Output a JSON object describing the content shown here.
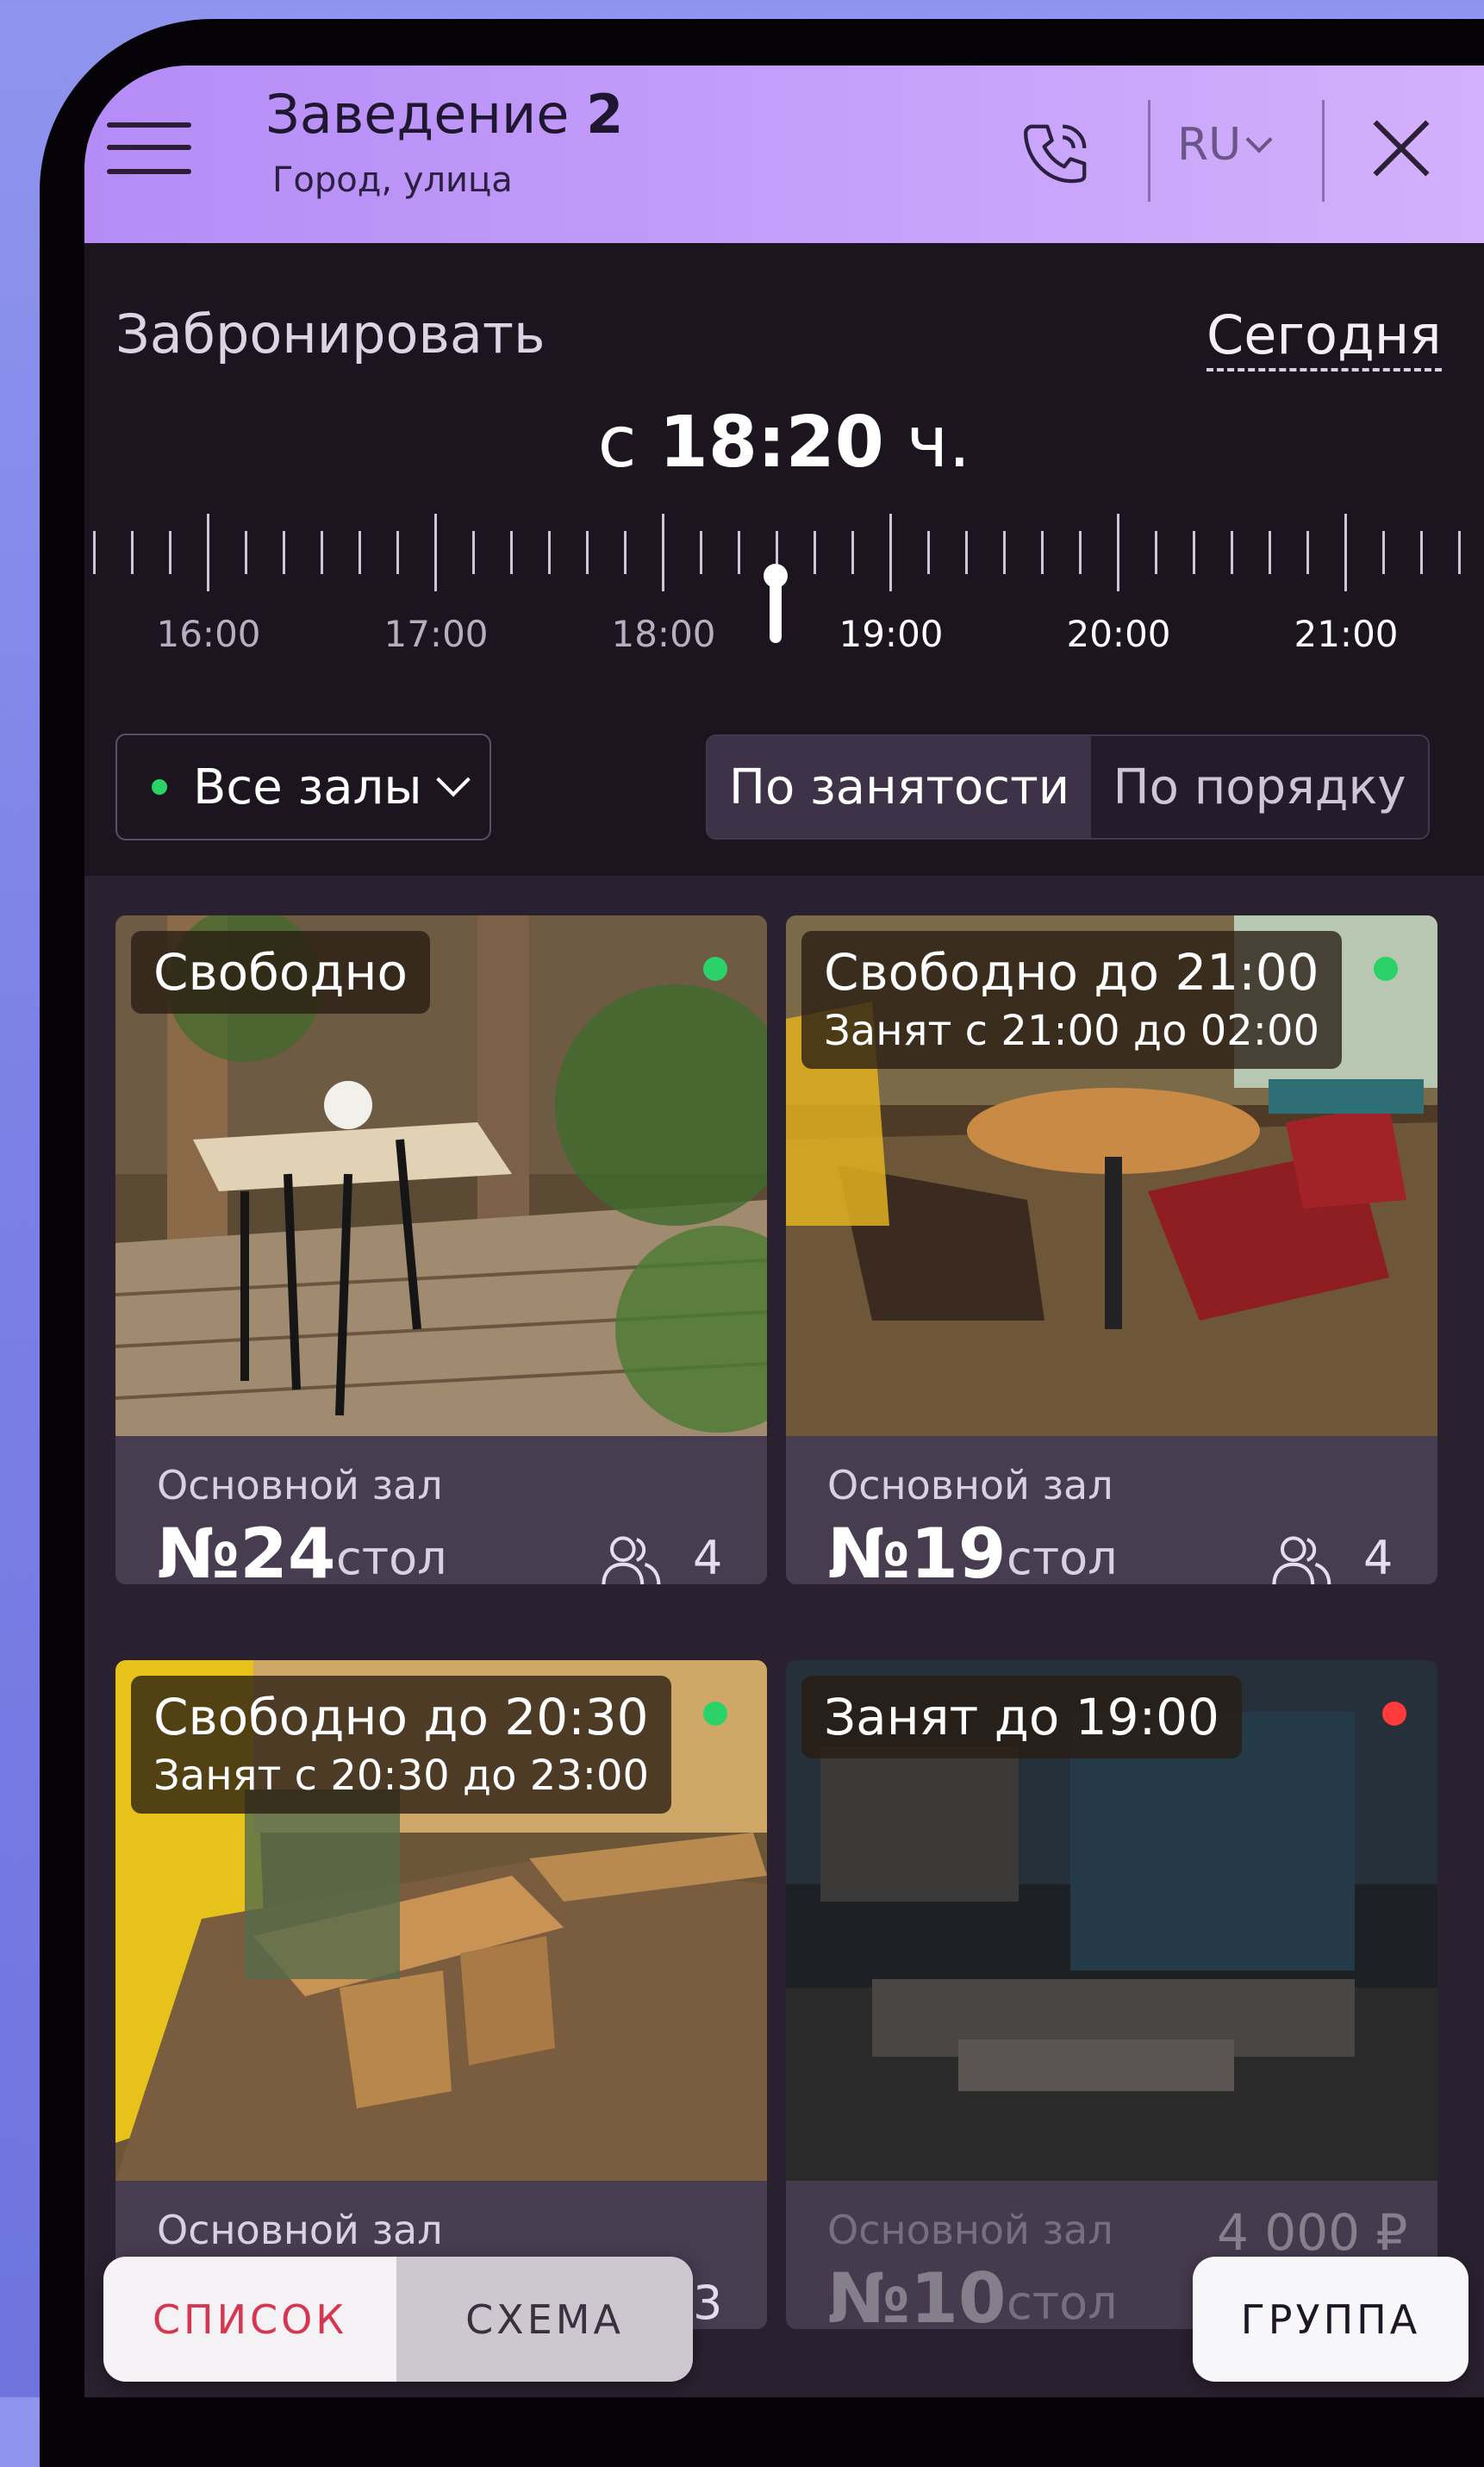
{
  "header": {
    "venue_name": "Заведение",
    "venue_number": "2",
    "address": "Город, улица",
    "language": "RU"
  },
  "booking": {
    "label": "Забронировать",
    "date": "Сегодня",
    "time_prefix": "с",
    "time_value": "18:20",
    "time_suffix": "ч.",
    "timeline_labels": [
      "16:00",
      "17:00",
      "18:00",
      "19:00",
      "20:00",
      "21:00"
    ]
  },
  "filters": {
    "hall": "Все залы",
    "sort_options": [
      "По занятости",
      "По порядку"
    ],
    "sort_selected": "По занятости"
  },
  "tables": [
    {
      "status": "Свободно",
      "status_sub": "",
      "hall": "Основной зал",
      "number": "№24",
      "word": "стол",
      "guests": "4",
      "indicator": "#2bd169"
    },
    {
      "status": "Свободно до 21:00",
      "status_sub": "Занят с 21:00 до 02:00",
      "hall": "Основной зал",
      "number": "№19",
      "word": "стол",
      "guests": "4",
      "indicator": "#2bd169"
    },
    {
      "status": "Свободно до 20:30",
      "status_sub": "Занят с 20:30 до 23:00",
      "hall": "Основной зал",
      "number": "",
      "word": "",
      "guests": "3",
      "indicator": "#2bd169"
    },
    {
      "status": "Занят до 19:00",
      "status_sub": "",
      "hall": "Основной зал",
      "number": "№10",
      "word": "стол",
      "guests": "",
      "price": "4 000 ₽",
      "indicator": "#ff3a3a"
    }
  ],
  "bottom": {
    "list_label": "СПИСОК",
    "scheme_label": "СХЕМА",
    "group_label": "ГРУППА"
  },
  "colors": {
    "accent": "#d6364f",
    "free": "#2bd169",
    "busy": "#ff3a3a",
    "header": "#c7a2fb"
  }
}
